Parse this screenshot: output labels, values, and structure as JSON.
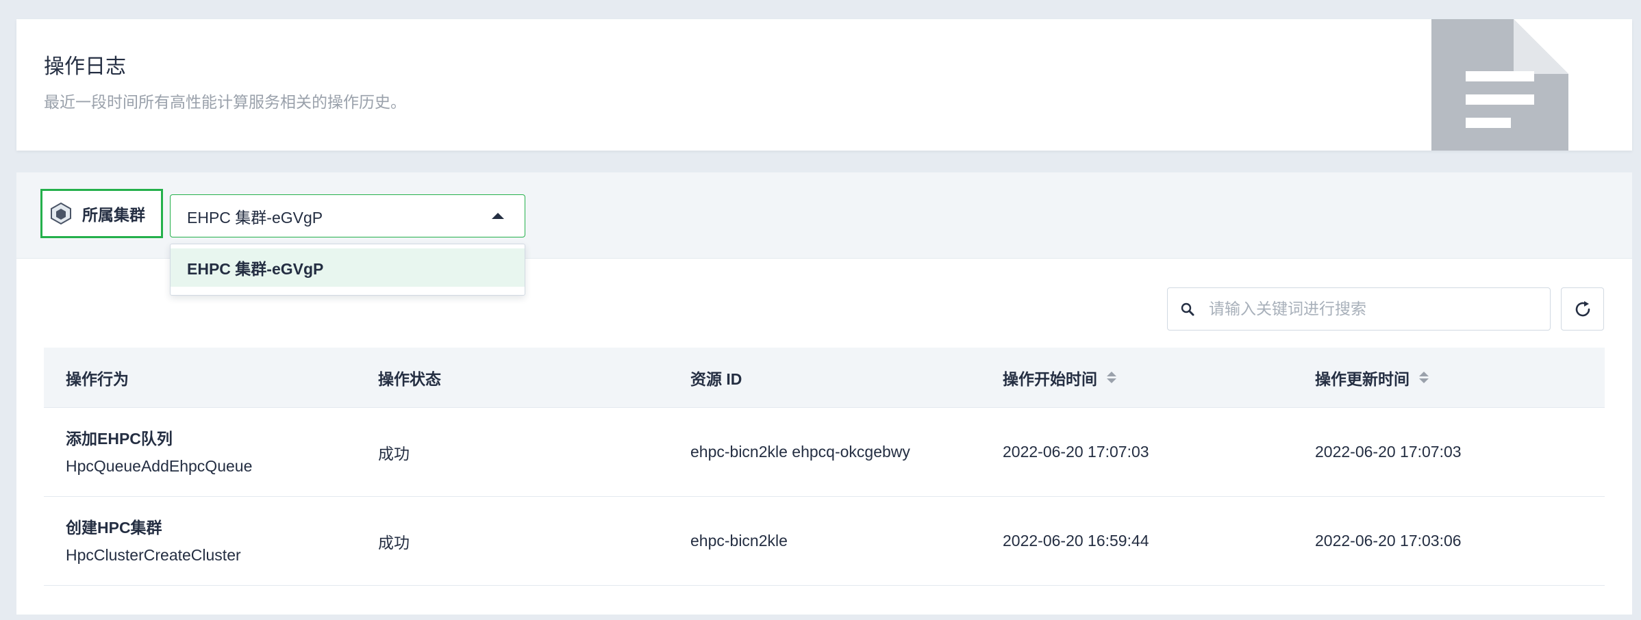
{
  "header": {
    "title": "操作日志",
    "description": "最近一段时间所有高性能计算服务相关的操作历史。"
  },
  "filter": {
    "label": "所属集群",
    "selected": "EHPC 集群-eGVgP",
    "options": [
      "EHPC 集群-eGVgP"
    ]
  },
  "toolbar": {
    "search_placeholder": "请输入关键词进行搜索"
  },
  "table": {
    "columns": [
      "操作行为",
      "操作状态",
      "资源 ID",
      "操作开始时间",
      "操作更新时间"
    ],
    "rows": [
      {
        "action_name": "添加EHPC队列",
        "action_code": "HpcQueueAddEhpcQueue",
        "status": "成功",
        "resource_id": "ehpc-bicn2kle ehpcq-okcgebwy",
        "start_time": "2022-06-20 17:07:03",
        "update_time": "2022-06-20 17:07:03"
      },
      {
        "action_name": "创建HPC集群",
        "action_code": "HpcClusterCreateCluster",
        "status": "成功",
        "resource_id": "ehpc-bicn2kle",
        "start_time": "2022-06-20 16:59:44",
        "update_time": "2022-06-20 17:03:06"
      }
    ]
  },
  "icons": {
    "cluster": "cube-icon",
    "search": "search-icon",
    "refresh": "refresh-icon",
    "illustration": "document-icon"
  },
  "colors": {
    "accent": "#24b04b",
    "selected_option_bg": "#e8f6ef"
  }
}
